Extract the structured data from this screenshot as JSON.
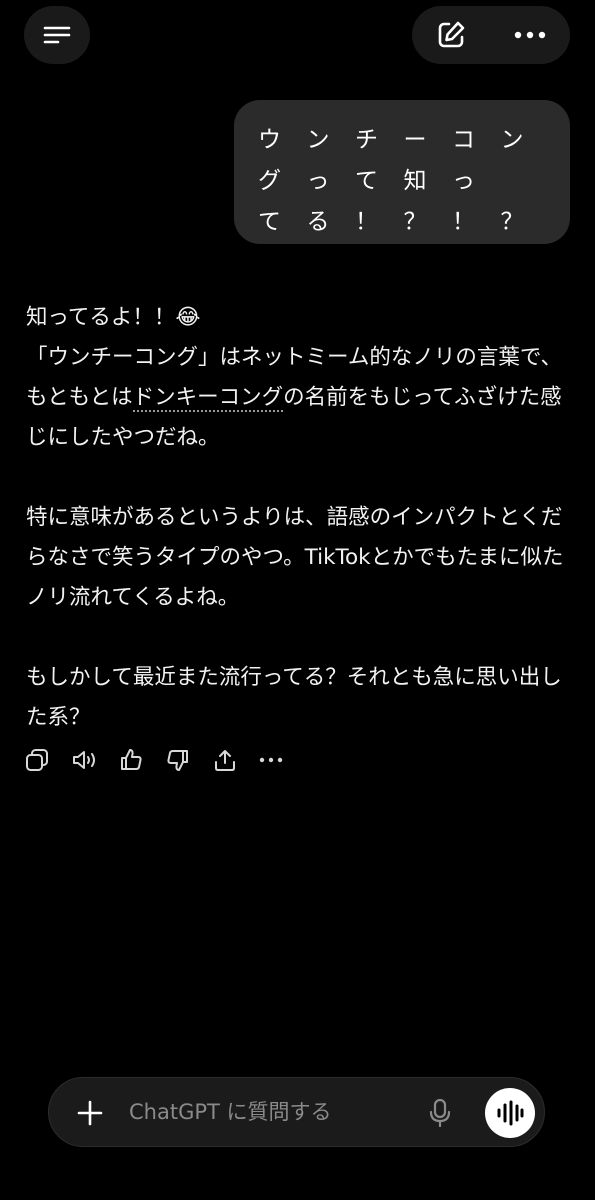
{
  "user_message": {
    "rows": [
      [
        "ウ",
        "ン",
        "チ",
        "ー",
        "コ",
        "ン"
      ],
      [
        "グ",
        "っ",
        "て",
        "知",
        "っ"
      ],
      [
        "て",
        "る",
        "！",
        "？",
        "！",
        "？"
      ]
    ]
  },
  "assistant_message": {
    "paragraphs": [
      {
        "segments": [
          "知ってるよ！！😂\n「ウンチーコング」はネットミーム的なノリの言葉で、もともとは",
          "ドンキーコング",
          "の名前をもじってふざけた感じにしたやつだね。"
        ]
      },
      {
        "segments": [
          "特に意味があるというよりは、語感のインパクトとくだらなさで笑うタイプのやつ。TikTokとかでもたまに似たノリ流れてくるよね。"
        ]
      },
      {
        "segments": [
          "もしかして最近また流行ってる？それとも急に思い出した系？"
        ]
      }
    ]
  },
  "composer": {
    "placeholder": "ChatGPT に質問する"
  },
  "icons": {
    "menu": "menu-icon",
    "new_chat": "edit-icon",
    "more": "more-icon",
    "copy": "copy-icon",
    "read_aloud": "speaker-icon",
    "like": "thumbs-up-icon",
    "dislike": "thumbs-down-icon",
    "share": "share-icon",
    "plus": "plus-icon",
    "mic": "mic-icon",
    "voice": "voice-mode-icon"
  }
}
